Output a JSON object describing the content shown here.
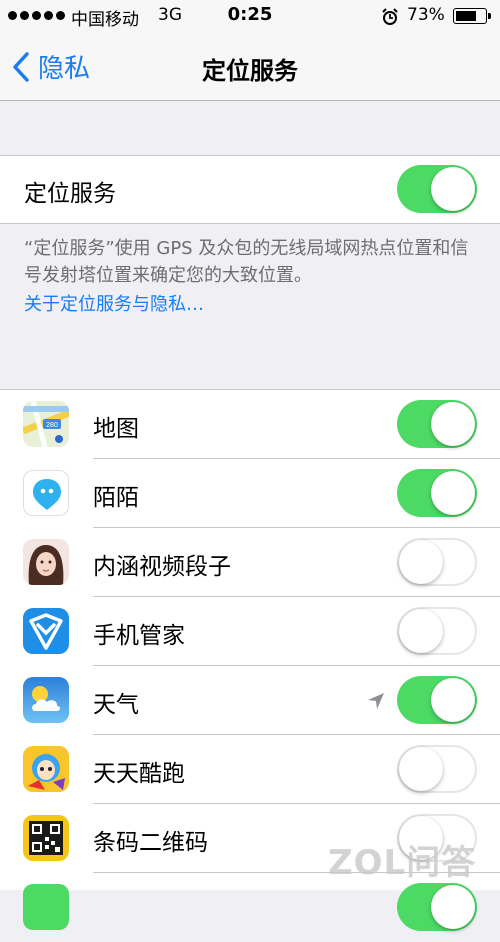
{
  "status_bar": {
    "carrier": "中国移动",
    "network": "3G",
    "time": "0:25",
    "battery_pct": "73%",
    "battery_level": 0.73
  },
  "nav": {
    "back_label": "隐私",
    "title": "定位服务"
  },
  "location_services": {
    "label": "定位服务",
    "enabled": true
  },
  "footer": {
    "note": "“定位服务”使用 GPS 及众包的无线局域网热点位置和信号发射塔位置来确定您的大致位置。",
    "link": "关于定位服务与隐私…"
  },
  "apps": [
    {
      "name": "地图",
      "icon": "maps-icon",
      "enabled": true
    },
    {
      "name": "陌陌",
      "icon": "momo-icon",
      "enabled": true
    },
    {
      "name": "内涵视频段子",
      "icon": "neihan-icon",
      "enabled": false
    },
    {
      "name": "手机管家",
      "icon": "phone-manager-icon",
      "enabled": false
    },
    {
      "name": "天气",
      "icon": "weather-icon",
      "enabled": true,
      "location_used": true
    },
    {
      "name": "天天酷跑",
      "icon": "tiantian-kupao-icon",
      "enabled": false
    },
    {
      "name": "条码二维码",
      "icon": "qr-code-icon",
      "enabled": false
    }
  ],
  "watermark": "ZOL问答",
  "colors": {
    "accent": "#1a7cf5",
    "toggle_on": "#4cd964",
    "background": "#efeff4"
  }
}
